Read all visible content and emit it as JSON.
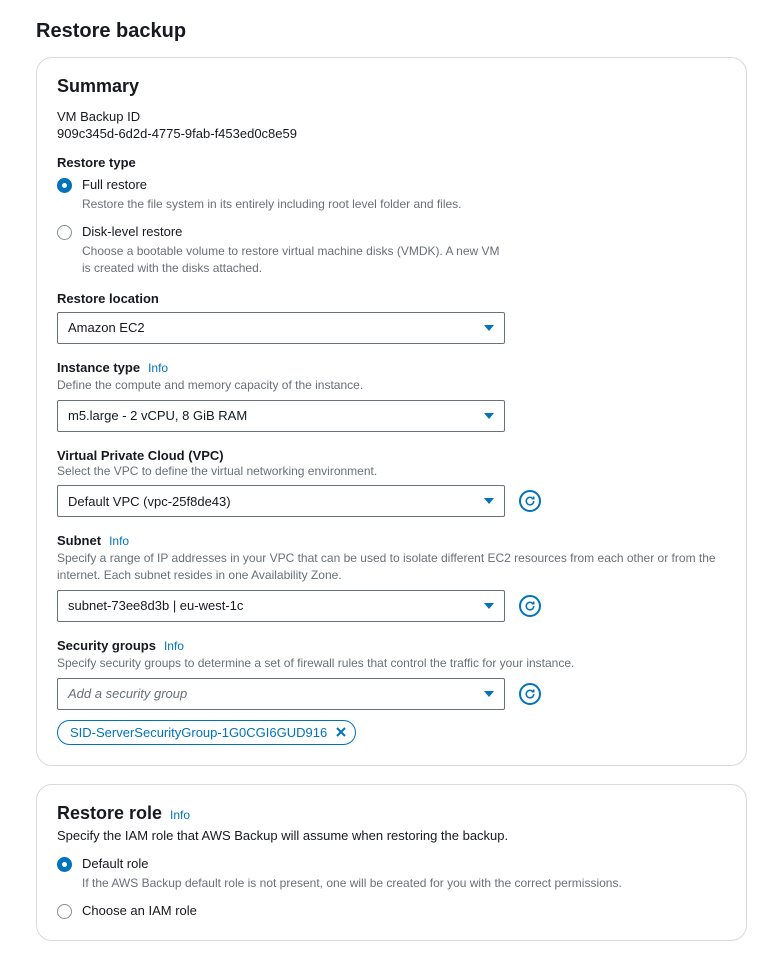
{
  "page": {
    "title": "Restore backup"
  },
  "summary": {
    "heading": "Summary",
    "backup_id_label": "VM Backup ID",
    "backup_id_value": "909c345d-6d2d-4775-9fab-f453ed0c8e59",
    "restore_type": {
      "label": "Restore type",
      "options": [
        {
          "title": "Full restore",
          "desc": "Restore the file system in its entirely including root level folder and files.",
          "selected": true
        },
        {
          "title": "Disk-level restore",
          "desc": "Choose a bootable volume to restore virtual machine disks (VMDK). A new VM is created with the disks attached.",
          "selected": false
        }
      ]
    },
    "restore_location": {
      "label": "Restore location",
      "value": "Amazon EC2"
    },
    "instance_type": {
      "label": "Instance type",
      "info": "Info",
      "help": "Define the compute and memory capacity of the instance.",
      "value": "m5.large - 2 vCPU, 8 GiB RAM"
    },
    "vpc": {
      "label": "Virtual Private Cloud (VPC)",
      "help": "Select the VPC to define the virtual networking environment.",
      "value": "Default VPC (vpc-25f8de43)"
    },
    "subnet": {
      "label": "Subnet",
      "info": "Info",
      "help": "Specify a range of IP addresses in your VPC that can be used to isolate different EC2 resources from each other or from the internet. Each subnet resides in one Availability Zone.",
      "value": "subnet-73ee8d3b | eu-west-1c"
    },
    "security_groups": {
      "label": "Security groups",
      "info": "Info",
      "help": "Specify security groups to determine a set of firewall rules that control the traffic for your instance.",
      "placeholder": "Add a security group",
      "tags": [
        "SID-ServerSecurityGroup-1G0CGI6GUD916"
      ]
    }
  },
  "restore_role": {
    "heading": "Restore role",
    "info": "Info",
    "desc": "Specify the IAM role that AWS Backup will assume when restoring the backup.",
    "options": [
      {
        "title": "Default role",
        "desc": "If the AWS Backup default role is not present, one will be created for you with the correct permissions.",
        "selected": true
      },
      {
        "title": "Choose an IAM role",
        "desc": "",
        "selected": false
      }
    ]
  }
}
